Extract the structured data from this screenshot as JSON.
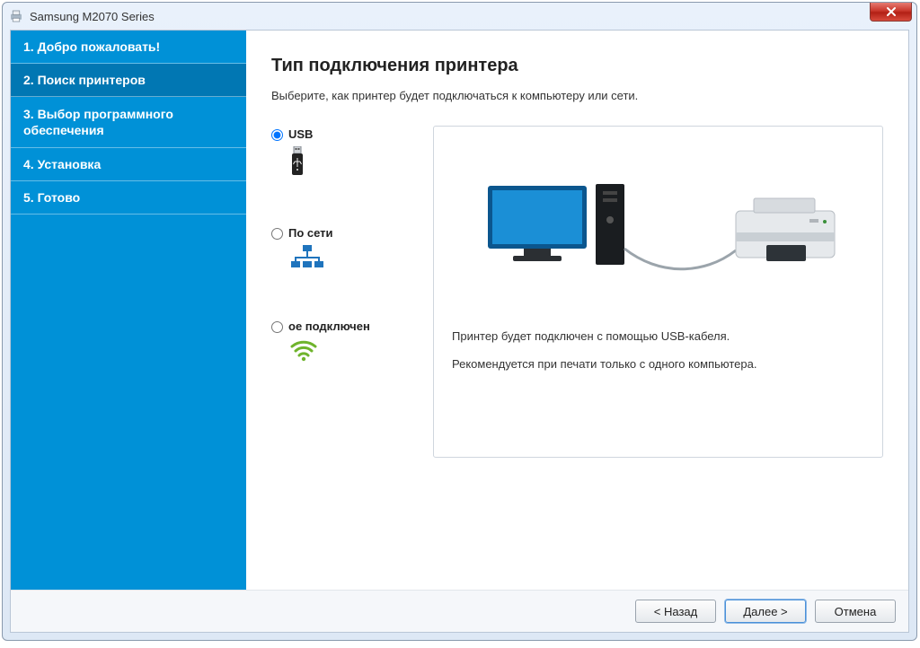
{
  "window": {
    "title": "Samsung M2070 Series",
    "close_tooltip": "Закрыть"
  },
  "sidebar": {
    "steps": [
      "1. Добро пожаловать!",
      "2. Поиск принтеров",
      "3. Выбор программного обеспечения",
      "4. Установка",
      "5. Готово"
    ],
    "active_index": 1
  },
  "main": {
    "heading": "Тип подключения принтера",
    "subtitle": "Выберите, как принтер будет подключаться к компьютеру или сети.",
    "options": [
      {
        "id": "usb",
        "label": "USB",
        "selected": true
      },
      {
        "id": "network",
        "label": "По сети",
        "selected": false
      },
      {
        "id": "wireless",
        "label": "ое подключен",
        "selected": false
      }
    ],
    "detail": {
      "line1": "Принтер будет подключен с помощью USB-кабеля.",
      "line2": "Рекомендуется при печати только с одного компьютера."
    }
  },
  "buttons": {
    "back": "< Назад",
    "next": "Далее >",
    "cancel": "Отмена"
  }
}
